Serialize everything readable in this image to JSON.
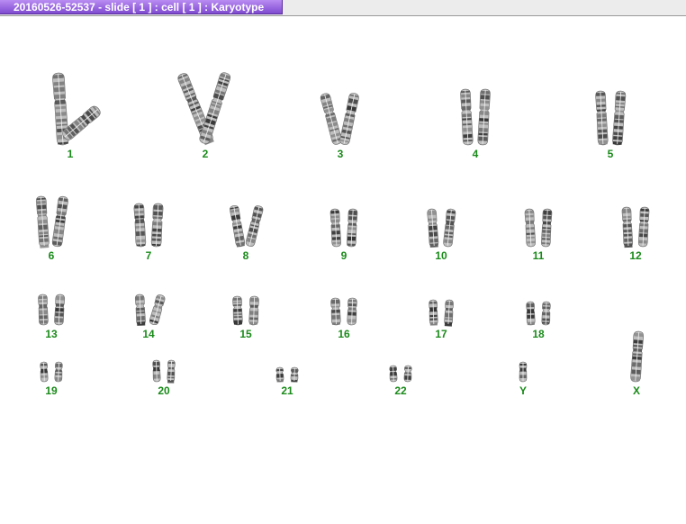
{
  "window": {
    "title": "20160526-52537 - slide [ 1 ] : cell [ 1 ] : Karyotype"
  },
  "karyotype": {
    "label_color": "#1a8a1a",
    "chromosomes": [
      {
        "id": "1"
      },
      {
        "id": "2"
      },
      {
        "id": "3"
      },
      {
        "id": "4"
      },
      {
        "id": "5"
      },
      {
        "id": "6"
      },
      {
        "id": "7"
      },
      {
        "id": "8"
      },
      {
        "id": "9"
      },
      {
        "id": "10"
      },
      {
        "id": "11"
      },
      {
        "id": "12"
      },
      {
        "id": "13"
      },
      {
        "id": "14"
      },
      {
        "id": "15"
      },
      {
        "id": "16"
      },
      {
        "id": "17"
      },
      {
        "id": "18"
      },
      {
        "id": "19"
      },
      {
        "id": "20"
      },
      {
        "id": "21"
      },
      {
        "id": "22"
      },
      {
        "id": "Y"
      },
      {
        "id": "X"
      }
    ]
  }
}
